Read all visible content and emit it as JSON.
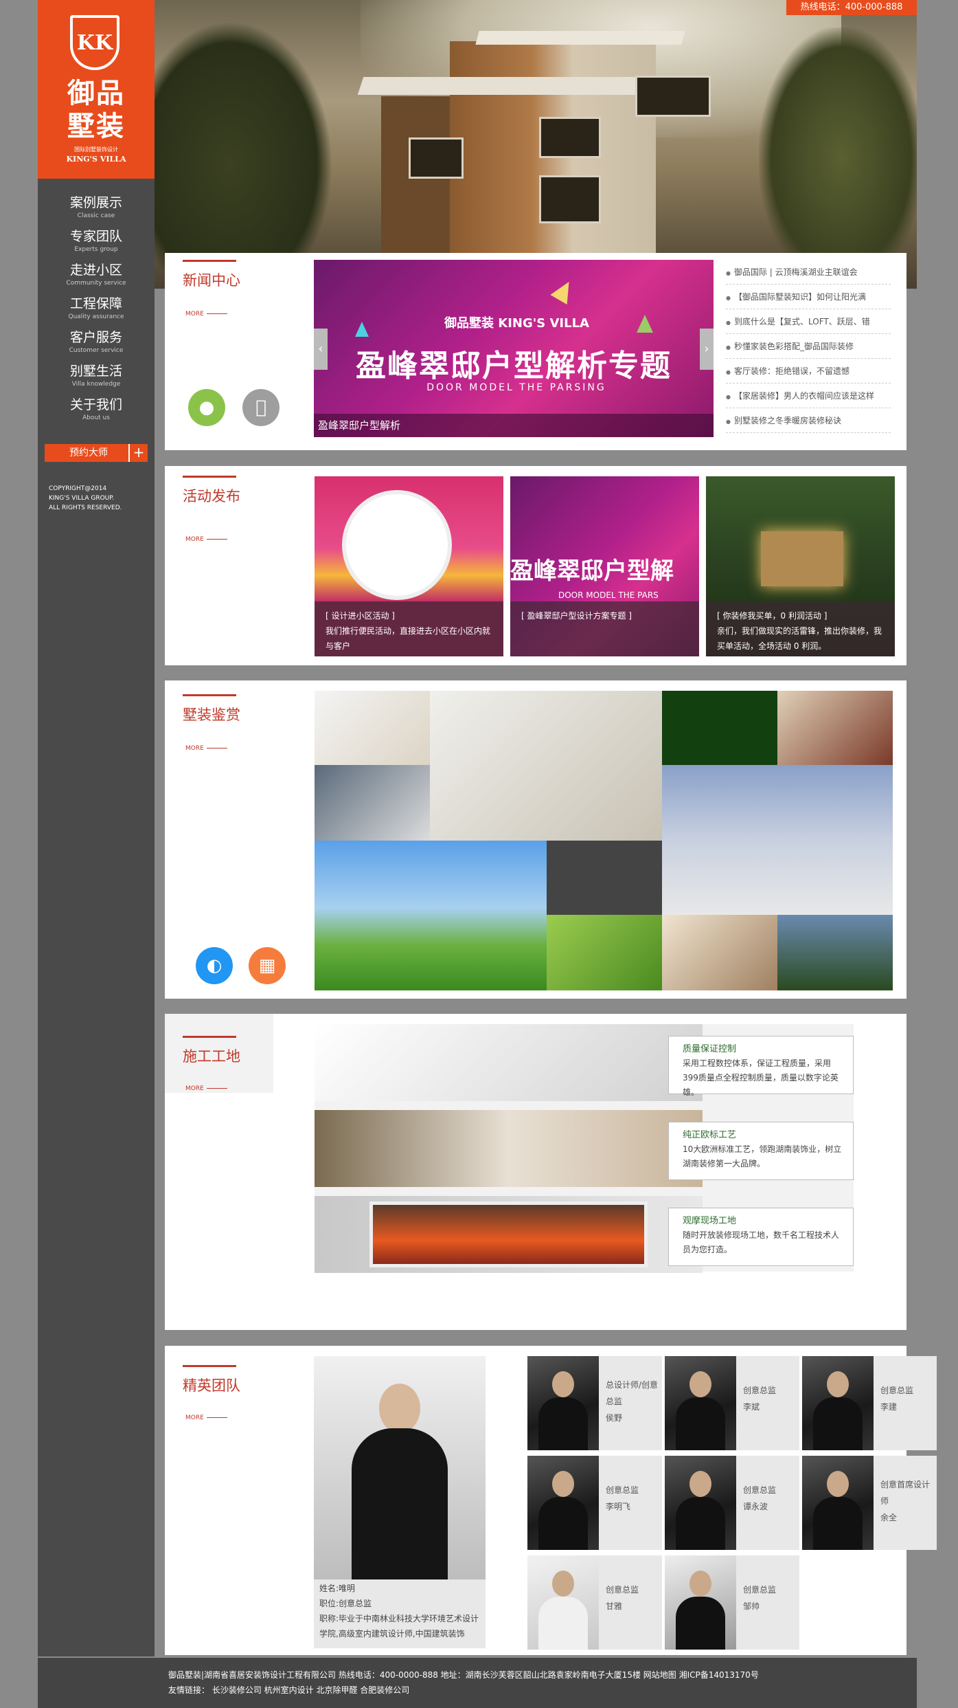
{
  "logo": {
    "mark": "KK",
    "name_line1": "御品",
    "name_line2": "墅装",
    "sub": "国际别墅装饰设计",
    "en": "KING'S VILLA"
  },
  "nav": [
    {
      "zh": "案例展示",
      "en": "Classic case"
    },
    {
      "zh": "专家团队",
      "en": "Experts group"
    },
    {
      "zh": "走进小区",
      "en": "Community service"
    },
    {
      "zh": "工程保障",
      "en": "Quality assurance"
    },
    {
      "zh": "客户服务",
      "en": "Customer service"
    },
    {
      "zh": "别墅生活",
      "en": "Villa knowledge"
    },
    {
      "zh": "关于我们",
      "en": "About us"
    }
  ],
  "book_label": "预约大师",
  "copyright": [
    "COPYRIGHT@2014",
    "KING'S VILLA GROUP.",
    "ALL RIGHTS RESERVED."
  ],
  "hotline": "热线电话：400-000-888",
  "news": {
    "title": "新闻中心",
    "more": "MORE",
    "banner_brand": "御品墅装 KING'S VILLA",
    "banner_title": "盈峰翠邸户型解析专题",
    "banner_en": "DOOR MODEL THE PARSING",
    "banner_caption": "盈峰翠邸户型解析",
    "items": [
      "御品国际 | 云顶梅溪湖业主联谊会",
      "【御品国际墅装知识】如何让阳光满",
      "到底什么是【复式、LOFT、跃层、错",
      "秒懂家装色彩搭配_御品国际装修",
      "客厅装修：拒绝错误，不留遗憾",
      "【家居装修】男人的衣帽间应该是这样",
      "别墅装修之冬季暖房装修秘诀"
    ]
  },
  "activity": {
    "title": "活动发布",
    "more": "MORE",
    "cards": [
      {
        "caption1": "[ 设计进小区活动 ]",
        "caption2": "我们推行便民活动，直接进去小区在小区内就与客户"
      },
      {
        "caption1": "[ 盈峰翠邸户型设计方案专题 ]",
        "caption2": "",
        "banner_text": "盈峰翠邸户型解",
        "banner_en": "DOOR MODEL THE PARS"
      },
      {
        "caption1": "[ 你装修我买单，0 利润活动 ]",
        "caption2": "亲们，我们做现实的活雷锋，推出你装修，我买单活动，全场活动 0 利润。"
      }
    ]
  },
  "gallery": {
    "title": "墅装鉴赏",
    "more": "MORE"
  },
  "construct": {
    "title": "施工工地",
    "more": "MORE",
    "rows": [
      {
        "heading": "质量保证控制",
        "text": "采用工程数控体系，保证工程质量，采用399质量点全程控制质量，质量以数字论英雄。"
      },
      {
        "heading": "纯正欧标工艺",
        "text": "10大欧洲标准工艺，领跑湖南装饰业，树立湖南装修第一大品牌。"
      },
      {
        "heading": "观摩现场工地",
        "text": "随时开放装修现场工地，数千名工程技术人员为您打造。"
      }
    ]
  },
  "team": {
    "title": "精英团队",
    "more": "MORE",
    "leader": {
      "name_line": "姓名:唯明",
      "role_line": "职位:创意总监",
      "title_line": "职称:毕业于中南林业科技大学环境艺术设计学院,高级室内建筑设计师,中国建筑装饰"
    },
    "members": [
      {
        "role": "总设计师/创意总监",
        "name": "侯野"
      },
      {
        "role": "创意总监",
        "name": "李斌"
      },
      {
        "role": "创意总监",
        "name": "李建"
      },
      {
        "role": "创意总监",
        "name": "李明飞"
      },
      {
        "role": "创意总监",
        "name": "谭永波"
      },
      {
        "role": "创意首席设计师",
        "name": "余全"
      },
      {
        "role": "创意总监",
        "name": "甘雅"
      },
      {
        "role": "创意总监",
        "name": "邹帅"
      }
    ]
  },
  "footer": {
    "line1": "御品墅装|湖南省喜居安装饰设计工程有限公司 热线电话：400-0000-888 地址：湖南长沙芙蓉区韶山北路袁家岭南电子大厦15楼 网站地图 湘ICP备14013170号",
    "line2": "友情链接： 长沙装修公司 杭州室内设计 北京除甲醛 合肥装修公司"
  },
  "colors": {
    "accent": "#e84c1c",
    "title_red": "#c0392b",
    "sidebar": "#4a4a4a",
    "page_bg": "#8a8a8a"
  }
}
